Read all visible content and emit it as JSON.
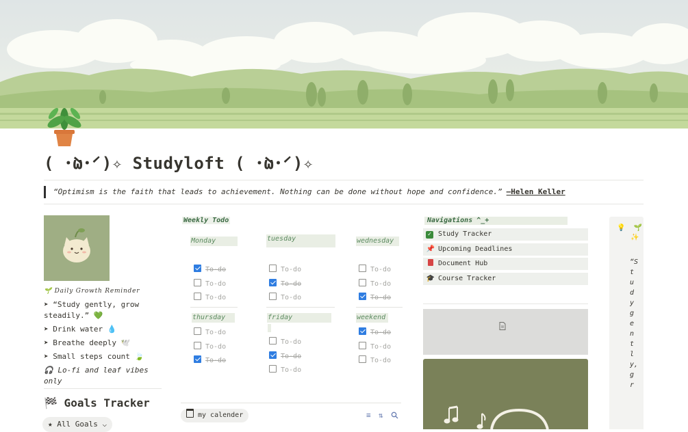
{
  "page": {
    "title": "( ･̀ω･́ )✧ Studyloft ( ･̀ω･́ )✧",
    "page_icon": "potted-plant-icon",
    "quote": "“Optimism is the faith that leads to achievement. Nothing can be done without hope and confidence.”",
    "quote_author": "—Helen Keller"
  },
  "left": {
    "reminder_heading": "🌱 Daily Growth Reminder",
    "items": [
      "➤ “Study gently, grow steadily.” 💚",
      "➤ Drink water 💧",
      "➤ Breathe deeply 🕊️",
      "➤ Small steps count 🍃"
    ],
    "lofi": "🎧 Lo-fi and leaf vibes only",
    "goals_title": "🏁 Goals Tracker",
    "goals_view": "★ All Goals ⌵"
  },
  "weekly": {
    "title": "Weekly Todo",
    "todo_label": "To-do",
    "days": [
      {
        "name": "Monday",
        "done": [
          true,
          false,
          false
        ]
      },
      {
        "name": "tuesday",
        "done": [
          false,
          true,
          false
        ]
      },
      {
        "name": "wednesday",
        "done": [
          false,
          false,
          true
        ]
      },
      {
        "name": "thursday",
        "done": [
          false,
          false,
          true
        ]
      },
      {
        "name": "friday",
        "done": [
          false,
          true,
          false
        ]
      },
      {
        "name": "weekend",
        "done": [
          true,
          false,
          false
        ]
      }
    ],
    "calendar_tab": "my calender"
  },
  "nav": {
    "title": "Navigations ^_+",
    "items": [
      {
        "icon": "☑",
        "label": "Study Tracker"
      },
      {
        "icon": "📌",
        "label": "Upcoming Deadlines"
      },
      {
        "icon": "📕",
        "label": "Document Hub"
      },
      {
        "icon": "🎓",
        "label": "Course Tracker"
      }
    ]
  },
  "callout": {
    "icons": "💡 🌱 ✨",
    "vertical_text": "“Study gently, gr"
  },
  "colors": {
    "checkbox": "#2f7de1",
    "accent_green": "#3c6b44",
    "embed_bg": "#7a8159"
  }
}
